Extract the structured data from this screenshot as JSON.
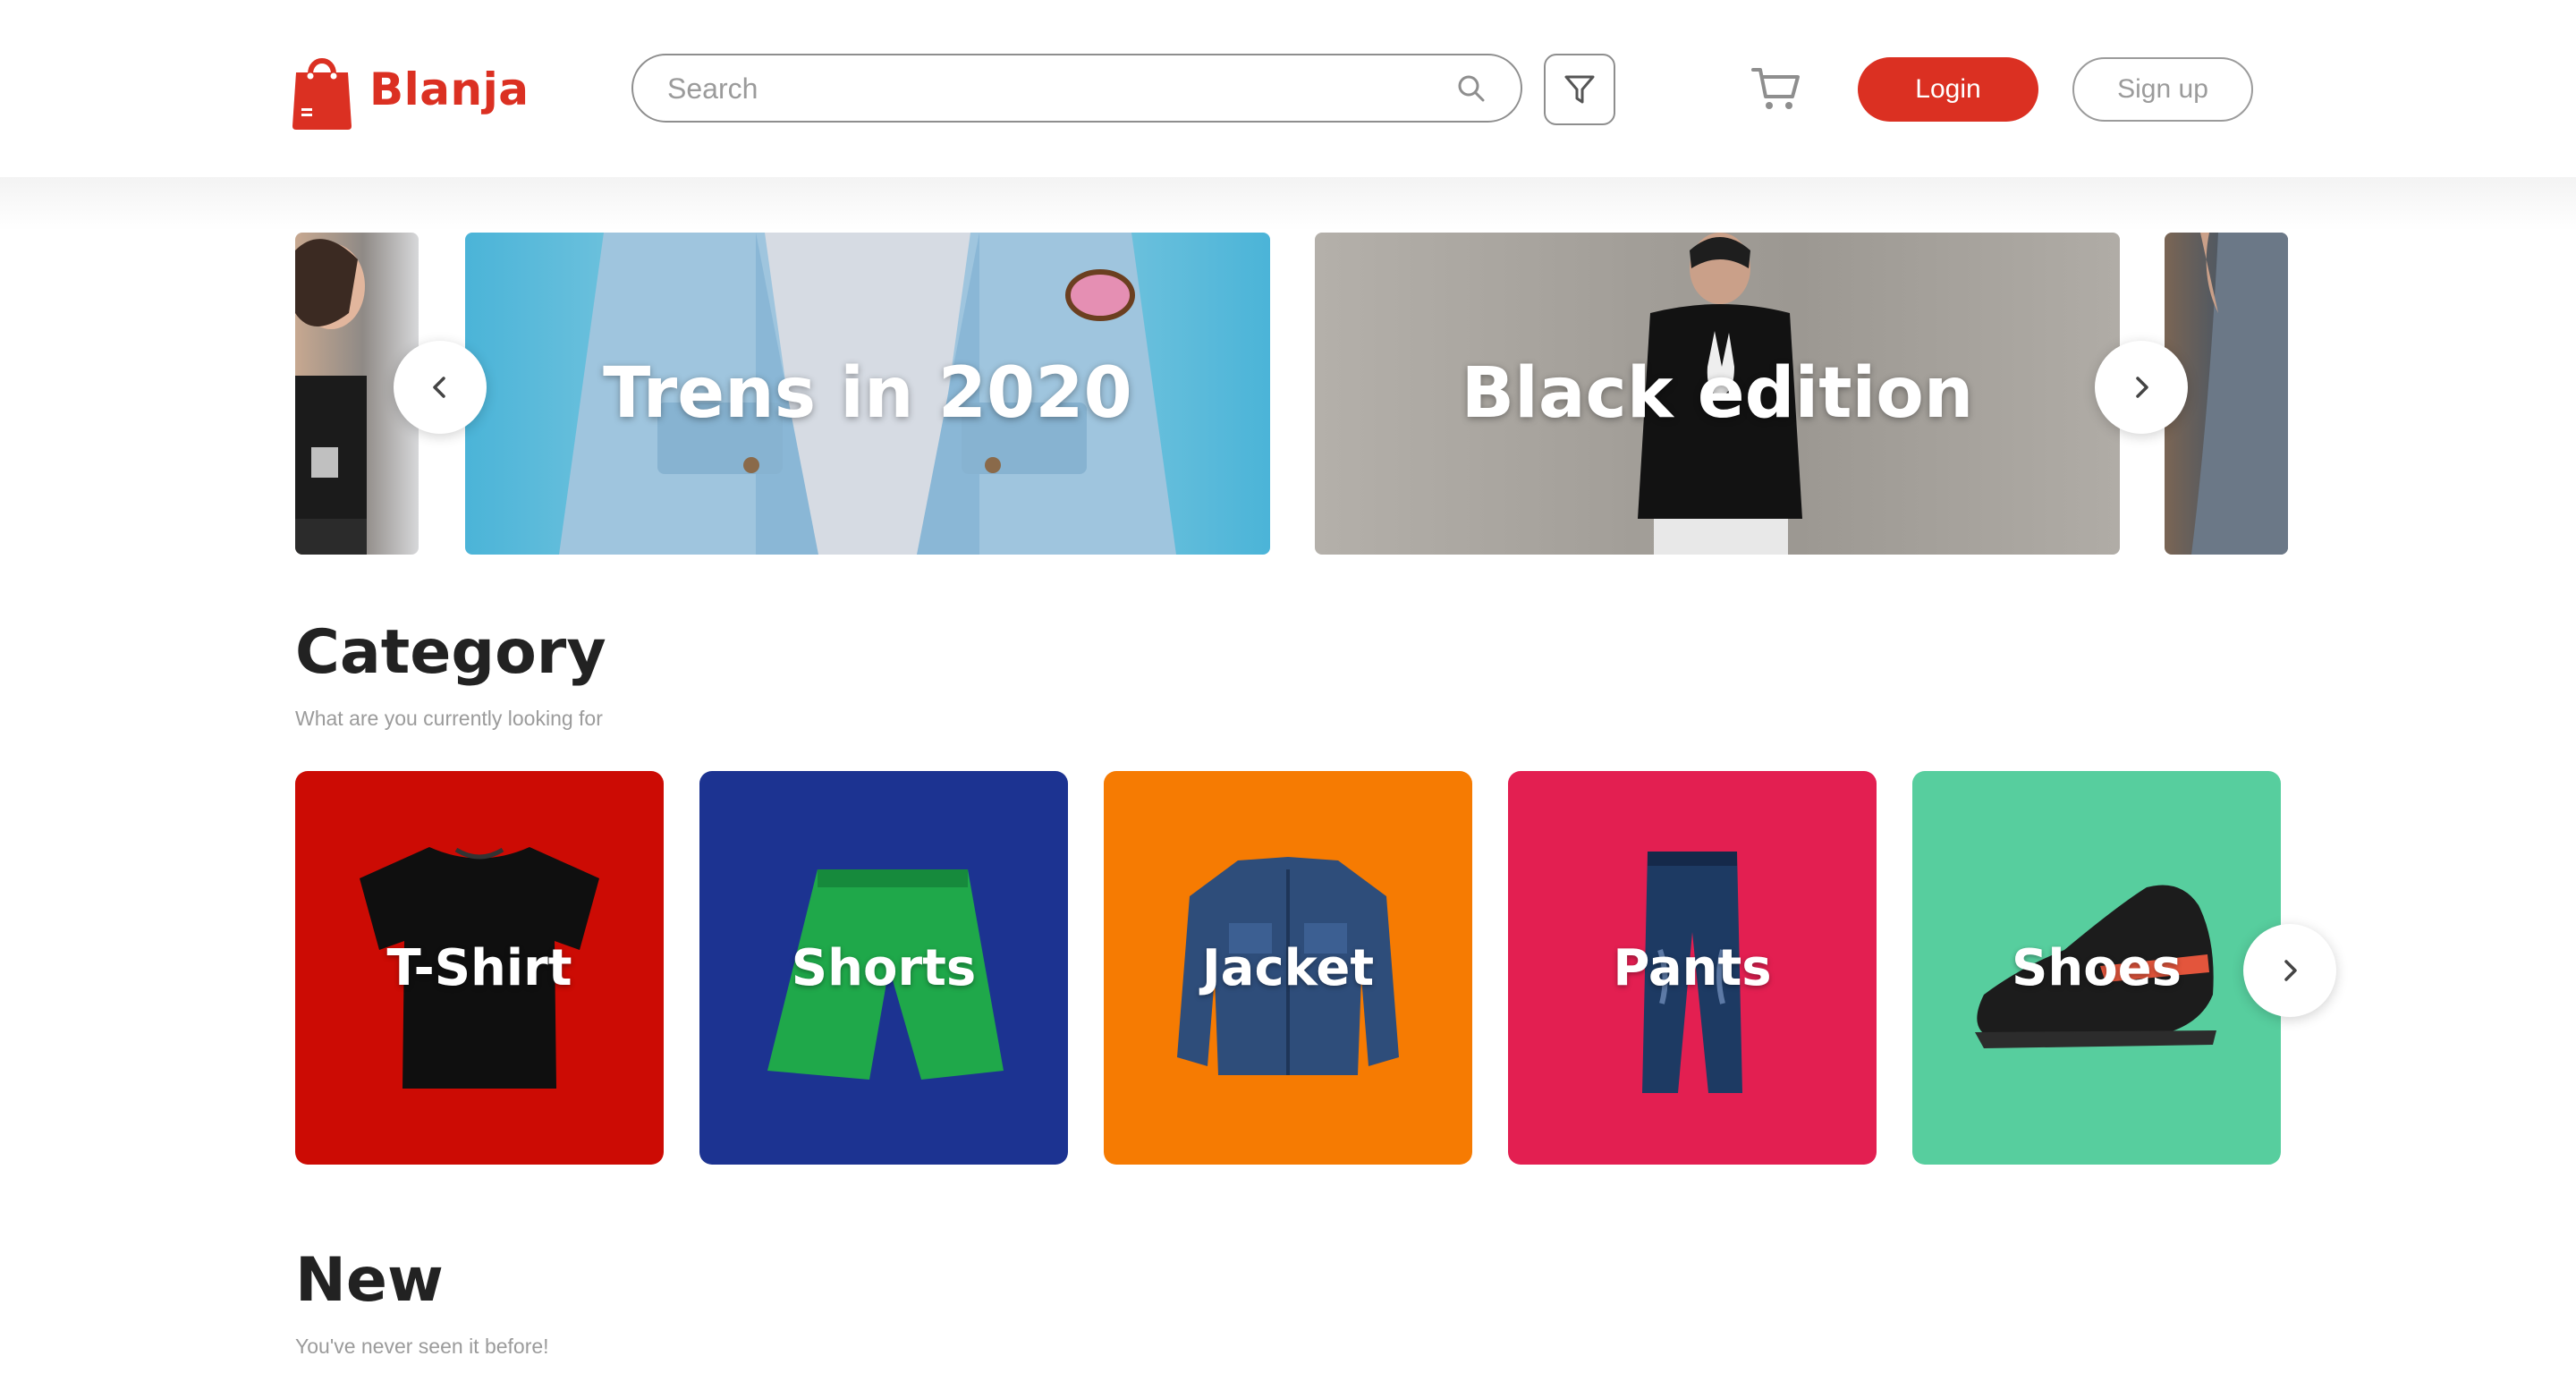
{
  "header": {
    "brand": "Blanja",
    "search_placeholder": "Search",
    "login_label": "Login",
    "signup_label": "Sign up",
    "accent_color": "#db3022"
  },
  "banners": [
    {
      "title": "Trens in 2020"
    },
    {
      "title": "Black edition"
    }
  ],
  "category": {
    "title": "Category",
    "subtitle": "What are you currently looking for",
    "items": [
      {
        "label": "T-Shirt",
        "color": "#cc0b04"
      },
      {
        "label": "Shorts",
        "color": "#1c3391"
      },
      {
        "label": "Jacket",
        "color": "#f67b02"
      },
      {
        "label": "Pants",
        "color": "#e31f51"
      },
      {
        "label": "Shoes",
        "color": "#57ce9e"
      }
    ]
  },
  "new_section": {
    "title": "New",
    "subtitle": "You've never seen it before!"
  }
}
